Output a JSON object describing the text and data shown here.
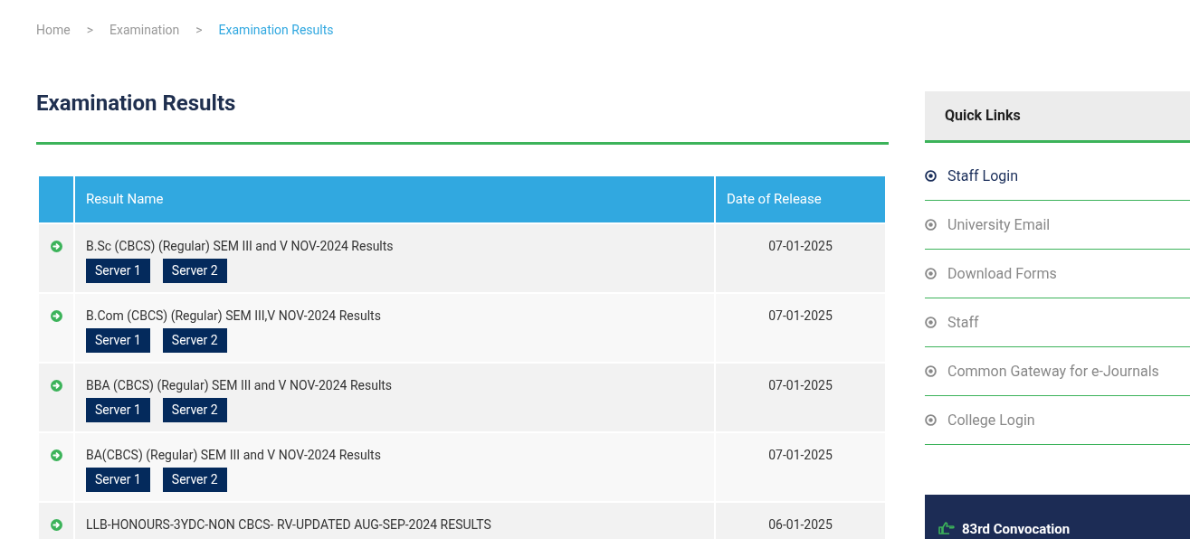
{
  "breadcrumb": [
    {
      "label": "Home",
      "selected": false
    },
    {
      "label": "Examination",
      "selected": false
    },
    {
      "label": "Examination Results",
      "selected": true
    }
  ],
  "breadcrumb_separator": ">",
  "page_title": "Examination Results",
  "table": {
    "columns": [
      "Result Name",
      "Date of Release"
    ],
    "rows": [
      {
        "name": "B.Sc (CBCS) (Regular) SEM III and V NOV-2024 Results",
        "buttons": [
          "Server 1",
          "Server 2"
        ],
        "date": "07-01-2025"
      },
      {
        "name": "B.Com (CBCS) (Regular) SEM III,V NOV-2024 Results",
        "buttons": [
          "Server 1",
          "Server 2"
        ],
        "date": "07-01-2025"
      },
      {
        "name": "BBA (CBCS) (Regular) SEM III and V NOV-2024 Results",
        "buttons": [
          "Server 1",
          "Server 2"
        ],
        "date": "07-01-2025"
      },
      {
        "name": "BA(CBCS) (Regular) SEM III and V NOV-2024 Results",
        "buttons": [
          "Server 1",
          "Server 2"
        ],
        "date": "07-01-2025"
      },
      {
        "name": "LLB-HONOURS-3YDC-NON CBCS- RV-UPDATED AUG-SEP-2024 RESULTS",
        "buttons": [],
        "date": "06-01-2025"
      }
    ]
  },
  "sidebar": {
    "title": "Quick Links",
    "items": [
      {
        "label": "Staff Login",
        "selected": true
      },
      {
        "label": "University Email",
        "selected": false
      },
      {
        "label": "Download Forms",
        "selected": false
      },
      {
        "label": "Staff",
        "selected": false
      },
      {
        "label": "Common Gateway for e-Journals",
        "selected": false
      },
      {
        "label": "College Login",
        "selected": false
      }
    ],
    "panel_title": "83rd Convocation"
  }
}
